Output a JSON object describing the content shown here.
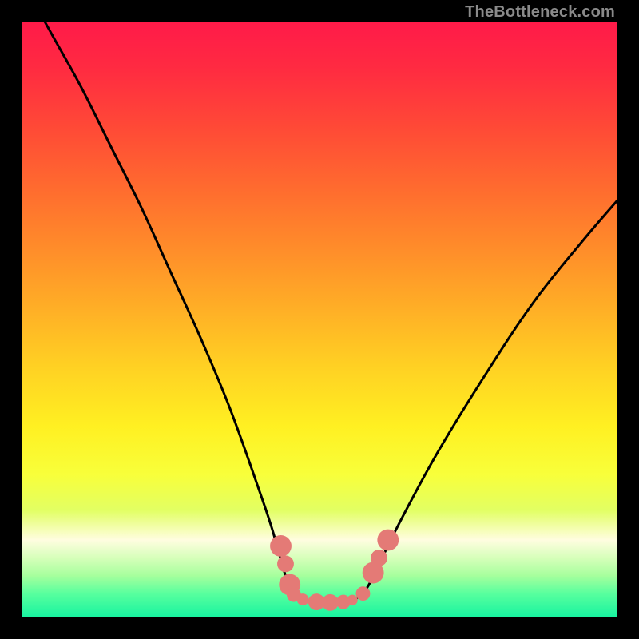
{
  "watermark": "TheBottleneck.com",
  "chart_data": {
    "type": "line",
    "title": "",
    "xlabel": "",
    "ylabel": "",
    "xlim": [
      0,
      100
    ],
    "ylim": [
      0,
      100
    ],
    "series": [
      {
        "name": "left-curve",
        "x": [
          0,
          5,
          10,
          15,
          20,
          25,
          30,
          35,
          40,
          42,
          44,
          45,
          46,
          47
        ],
        "y": [
          107,
          98,
          89,
          79,
          69,
          58,
          47,
          35,
          21,
          15,
          8,
          5,
          3.5,
          3
        ],
        "color": "#000000"
      },
      {
        "name": "flat-bottom",
        "x": [
          47,
          49,
          51,
          53,
          55,
          56
        ],
        "y": [
          3,
          2.5,
          2.4,
          2.5,
          2.7,
          3
        ],
        "color": "#000000"
      },
      {
        "name": "right-curve",
        "x": [
          56,
          58,
          60,
          64,
          70,
          78,
          86,
          94,
          100
        ],
        "y": [
          3,
          5,
          9,
          17,
          28,
          41,
          53,
          63,
          70
        ],
        "color": "#000000"
      }
    ],
    "markers": [
      {
        "x": 43.5,
        "y": 12,
        "r": 1.8
      },
      {
        "x": 44.3,
        "y": 9,
        "r": 1.4
      },
      {
        "x": 45.0,
        "y": 5.5,
        "r": 1.8
      },
      {
        "x": 45.7,
        "y": 3.8,
        "r": 1.2
      },
      {
        "x": 47.2,
        "y": 3.0,
        "r": 1.0
      },
      {
        "x": 49.5,
        "y": 2.6,
        "r": 1.4
      },
      {
        "x": 51.8,
        "y": 2.5,
        "r": 1.4
      },
      {
        "x": 54.0,
        "y": 2.6,
        "r": 1.2
      },
      {
        "x": 55.5,
        "y": 2.9,
        "r": 0.9
      },
      {
        "x": 57.3,
        "y": 4.0,
        "r": 1.2
      },
      {
        "x": 59.0,
        "y": 7.5,
        "r": 1.8
      },
      {
        "x": 60.0,
        "y": 10.0,
        "r": 1.4
      },
      {
        "x": 61.5,
        "y": 13.0,
        "r": 1.8
      }
    ],
    "marker_color": "#e47a76"
  }
}
